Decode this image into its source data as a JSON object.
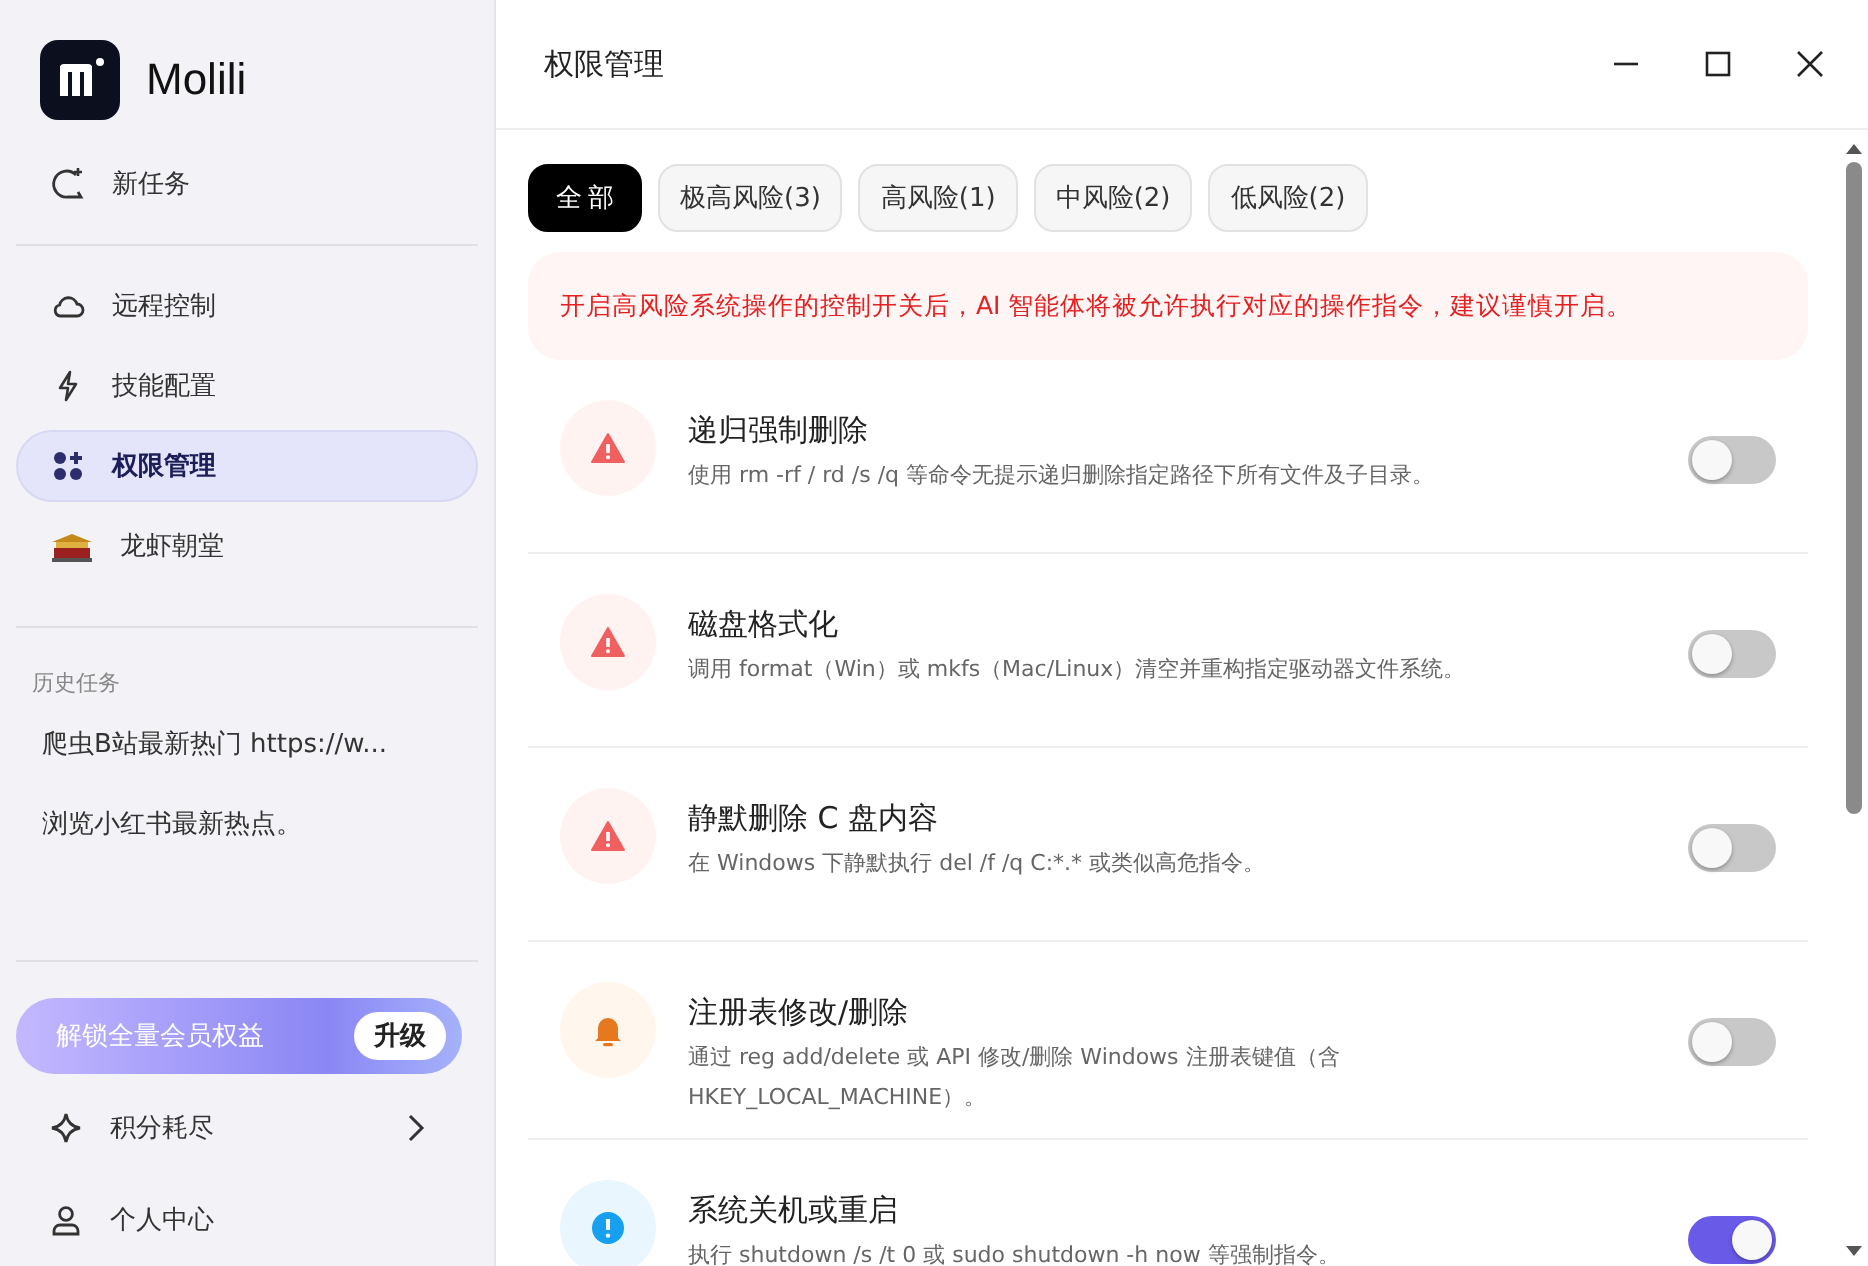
{
  "app": {
    "name": "Molili"
  },
  "nav_top": [
    {
      "label": "新任务",
      "selected": false
    }
  ],
  "nav": [
    {
      "label": "远程控制",
      "selected": false
    },
    {
      "label": "技能配置",
      "selected": false
    },
    {
      "label": "权限管理",
      "selected": true
    },
    {
      "label": "龙虾朝堂",
      "selected": false
    }
  ],
  "history": {
    "title": "历史任务",
    "items": [
      "爬虫B站最新热门 https://w...",
      "浏览小红书最新热点。"
    ]
  },
  "upgrade": {
    "text": "解锁全量会员权益",
    "button": "升级"
  },
  "footer_nav": [
    {
      "label": "积分耗尽"
    },
    {
      "label": "个人中心"
    }
  ],
  "window": {
    "title": "权限管理"
  },
  "tabs": [
    {
      "label": "全部",
      "selected": true
    },
    {
      "label": "极高风险(3)",
      "selected": false
    },
    {
      "label": "高风险(1)",
      "selected": false
    },
    {
      "label": "中风险(2)",
      "selected": false
    },
    {
      "label": "低风险(2)",
      "selected": false
    }
  ],
  "notice": "开启高风险系统操作的控制开关后，AI 智能体将被允许执行对应的操作指令，建议谨慎开启。",
  "rules": [
    {
      "kind": "danger",
      "title": "递归强制删除",
      "description": "使用 rm -rf / rd /s /q 等命令无提示递归删除指定路径下所有文件及子目录。",
      "on": false
    },
    {
      "kind": "danger",
      "title": "磁盘格式化",
      "description": "调用 format（Win）或 mkfs（Mac/Linux）清空并重构指定驱动器文件系统。",
      "on": false
    },
    {
      "kind": "danger",
      "title": "静默删除 C 盘内容",
      "description": "在 Windows 下静默执行 del /f /q C:*.* 或类似高危指令。",
      "on": false
    },
    {
      "kind": "warning",
      "title": "注册表修改/删除",
      "description": "通过 reg add/delete 或 API 修改/删除 Windows 注册表键值（含 HKEY_LOCAL_MACHINE）。",
      "on": false
    },
    {
      "kind": "info",
      "title": "系统关机或重启",
      "description": "执行 shutdown /s /t 0 或 sudo shutdown -h now 等强制指令。",
      "on": true
    }
  ]
}
